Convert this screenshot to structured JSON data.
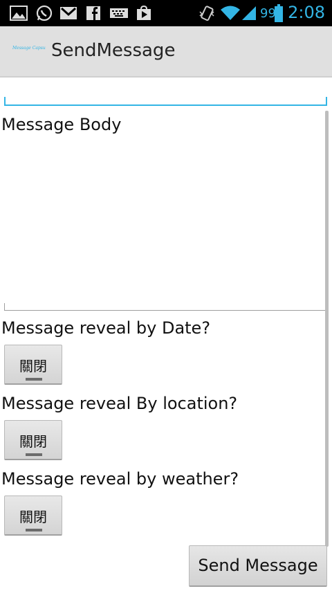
{
  "status_bar": {
    "battery_level": "99",
    "time": "2:08",
    "icons": [
      "gallery-icon",
      "whatsapp-icon",
      "gmail-icon",
      "facebook-icon",
      "keyboard-icon",
      "play-store-icon",
      "vibrate-icon",
      "wifi-icon",
      "signal-icon",
      "battery-icon"
    ]
  },
  "action_bar": {
    "logo_text": "Message Capsule",
    "title": "SendMessage"
  },
  "form": {
    "recipient_value": "",
    "body_placeholder": "Message Body",
    "reveal_date_label": "Message reveal by Date?",
    "reveal_date_toggle": "關閉",
    "reveal_location_label": "Message reveal By location?",
    "reveal_location_toggle": "關閉",
    "reveal_weather_label": "Message reveal by weather?",
    "reveal_weather_toggle": "關閉",
    "send_button": "Send Message"
  },
  "colors": {
    "accent": "#33b5e5",
    "action_bar_bg": "#e0e0e0",
    "status_bar_bg": "#000000"
  }
}
